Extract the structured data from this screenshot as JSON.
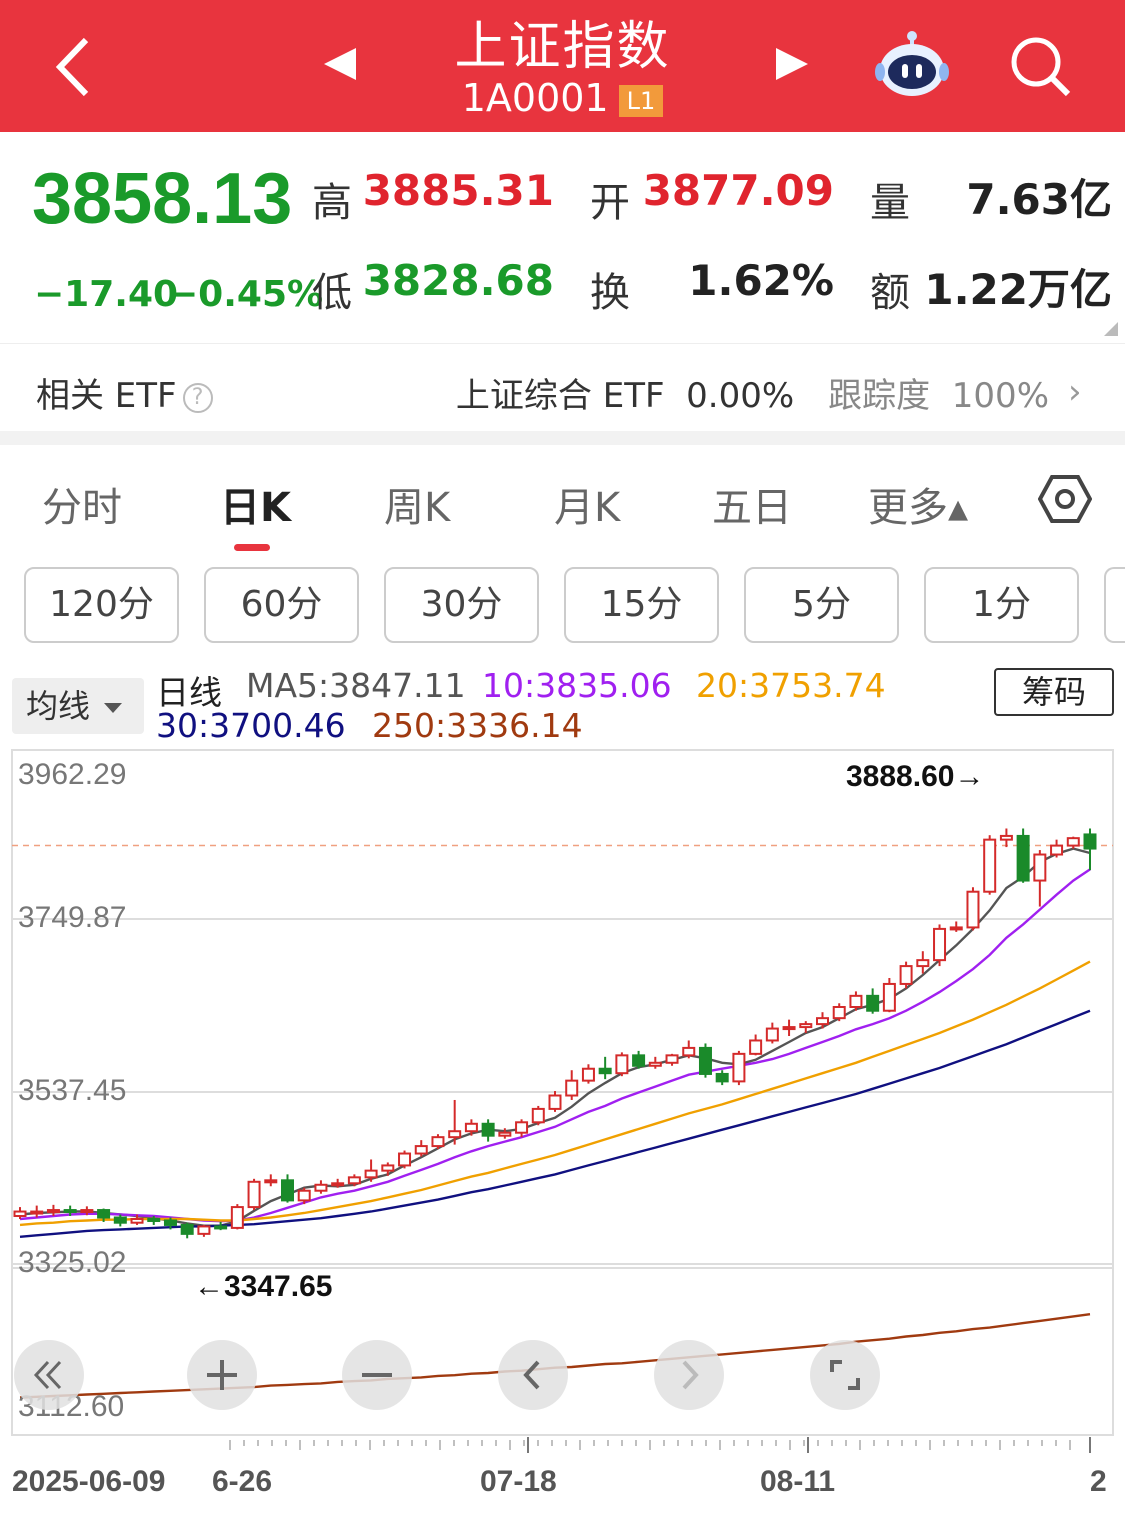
{
  "header": {
    "title": "上证指数",
    "code": "1A0001",
    "level_badge": "L1",
    "icons": [
      "back-icon",
      "prev-icon",
      "next-icon",
      "robot-icon",
      "search-icon"
    ]
  },
  "quote": {
    "price": "3858.13",
    "change": "−17.40",
    "change_pct": "−0.45%",
    "high_label": "高",
    "high": "3885.31",
    "low_label": "低",
    "low": "3828.68",
    "open_label": "开",
    "open": "3877.09",
    "turnover_label": "换",
    "turnover": "1.62%",
    "volume_label": "量",
    "volume": "7.63亿",
    "amount_label": "额",
    "amount": "1.22万亿"
  },
  "etf": {
    "label": "相关 ETF",
    "help": "?",
    "name": "上证综合 ETF",
    "pct": "0.00%",
    "tracking_label": "跟踪度",
    "tracking": "100%"
  },
  "tabs": [
    "分时",
    "日K",
    "周K",
    "月K",
    "五日",
    "更多▴"
  ],
  "active_tab": "日K",
  "periods": [
    "120分",
    "60分",
    "30分",
    "15分",
    "5分",
    "1分"
  ],
  "ma": {
    "toggle": "均线",
    "line_label": "日线",
    "ma5": "MA5:3847.11",
    "ma10": "10:3835.06",
    "ma20": "20:3753.74",
    "ma30": "30:3700.46",
    "ma250": "250:3336.14",
    "chip_button": "筹码",
    "colors": {
      "ma5": "#555555",
      "ma10": "#a020f0",
      "ma20": "#f0a000",
      "ma30": "#101080",
      "ma250": "#a03a10",
      "up": "#d42a2a",
      "down": "#1a8a2a"
    }
  },
  "chart_data": {
    "type": "candlestick",
    "y_ticks": [
      "3962.29",
      "3749.87",
      "3537.45",
      "3325.02",
      "3112.60"
    ],
    "x_ticks": [
      "2025-06-09",
      "6-26",
      "07-18",
      "08-11",
      "2"
    ],
    "max_label": "3888.60→",
    "min_label": "←3347.65",
    "ylim": [
      3112.6,
      3962.29
    ],
    "candles": [
      [
        3364,
        3370,
        3376,
        3360
      ],
      [
        3369,
        3370,
        3378,
        3362
      ],
      [
        3370,
        3372,
        3379,
        3364
      ],
      [
        3372,
        3370,
        3378,
        3364
      ],
      [
        3370,
        3372,
        3377,
        3365
      ],
      [
        3372,
        3362,
        3374,
        3356
      ],
      [
        3362,
        3355,
        3366,
        3350
      ],
      [
        3355,
        3360,
        3366,
        3352
      ],
      [
        3360,
        3358,
        3364,
        3352
      ],
      [
        3358,
        3352,
        3362,
        3346
      ],
      [
        3352,
        3340,
        3355,
        3334
      ],
      [
        3340,
        3350,
        3352,
        3336
      ],
      [
        3350,
        3348,
        3356,
        3345
      ],
      [
        3348,
        3376,
        3380,
        3346
      ],
      [
        3376,
        3410,
        3414,
        3372
      ],
      [
        3410,
        3412,
        3420,
        3404
      ],
      [
        3412,
        3385,
        3420,
        3382
      ],
      [
        3385,
        3398,
        3402,
        3380
      ],
      [
        3398,
        3406,
        3412,
        3394
      ],
      [
        3406,
        3408,
        3414,
        3402
      ],
      [
        3408,
        3416,
        3420,
        3404
      ],
      [
        3416,
        3425,
        3440,
        3410
      ],
      [
        3425,
        3432,
        3436,
        3418
      ],
      [
        3432,
        3448,
        3452,
        3428
      ],
      [
        3448,
        3458,
        3466,
        3444
      ],
      [
        3458,
        3470,
        3474,
        3454
      ],
      [
        3470,
        3478,
        3520,
        3460
      ],
      [
        3478,
        3488,
        3494,
        3472
      ],
      [
        3488,
        3472,
        3494,
        3464
      ],
      [
        3472,
        3476,
        3482,
        3468
      ],
      [
        3476,
        3490,
        3494,
        3470
      ],
      [
        3490,
        3508,
        3512,
        3486
      ],
      [
        3508,
        3526,
        3532,
        3504
      ],
      [
        3526,
        3546,
        3560,
        3520
      ],
      [
        3546,
        3562,
        3568,
        3542
      ],
      [
        3562,
        3556,
        3578,
        3548
      ],
      [
        3556,
        3580,
        3584,
        3552
      ],
      [
        3580,
        3566,
        3586,
        3562
      ],
      [
        3566,
        3570,
        3578,
        3562
      ],
      [
        3570,
        3580,
        3582,
        3566
      ],
      [
        3580,
        3590,
        3600,
        3576
      ],
      [
        3590,
        3555,
        3596,
        3550
      ],
      [
        3555,
        3545,
        3560,
        3540
      ],
      [
        3545,
        3582,
        3586,
        3540
      ],
      [
        3582,
        3600,
        3608,
        3580
      ],
      [
        3600,
        3616,
        3624,
        3596
      ],
      [
        3616,
        3618,
        3628,
        3606
      ],
      [
        3618,
        3622,
        3626,
        3610
      ],
      [
        3622,
        3630,
        3638,
        3616
      ],
      [
        3630,
        3645,
        3650,
        3626
      ],
      [
        3645,
        3660,
        3666,
        3640
      ],
      [
        3660,
        3640,
        3670,
        3636
      ],
      [
        3640,
        3676,
        3684,
        3638
      ],
      [
        3676,
        3700,
        3706,
        3670
      ],
      [
        3700,
        3708,
        3720,
        3690
      ],
      [
        3708,
        3750,
        3756,
        3700
      ],
      [
        3750,
        3752,
        3760,
        3746
      ],
      [
        3752,
        3800,
        3806,
        3748
      ],
      [
        3800,
        3870,
        3876,
        3796
      ],
      [
        3870,
        3875,
        3885,
        3860
      ],
      [
        3875,
        3815,
        3885,
        3812
      ],
      [
        3815,
        3850,
        3856,
        3780
      ],
      [
        3850,
        3862,
        3870,
        3846
      ],
      [
        3862,
        3872,
        3874,
        3858
      ],
      [
        3877,
        3858,
        3885,
        3829
      ]
    ],
    "series": [
      {
        "name": "MA5",
        "values": [
          3366,
          3368,
          3369,
          3370,
          3370,
          3368,
          3366,
          3364,
          3361,
          3358,
          3354,
          3351,
          3351,
          3357,
          3371,
          3384,
          3393,
          3402,
          3405,
          3404,
          3406,
          3414,
          3420,
          3432,
          3443,
          3455,
          3467,
          3475,
          3480,
          3478,
          3481,
          3489,
          3496,
          3511,
          3529,
          3543,
          3556,
          3564,
          3568,
          3574,
          3580,
          3576,
          3570,
          3568,
          3574,
          3586,
          3598,
          3610,
          3618,
          3630,
          3642,
          3648,
          3656,
          3670,
          3688,
          3708,
          3728,
          3750,
          3775,
          3805,
          3820,
          3840,
          3851,
          3858,
          3852
        ]
      },
      {
        "name": "MA10",
        "values": [
          3360,
          3362,
          3364,
          3366,
          3367,
          3367,
          3366,
          3365,
          3364,
          3362,
          3360,
          3358,
          3357,
          3358,
          3362,
          3368,
          3375,
          3382,
          3389,
          3394,
          3398,
          3404,
          3410,
          3418,
          3426,
          3434,
          3443,
          3451,
          3458,
          3464,
          3470,
          3477,
          3484,
          3494,
          3504,
          3512,
          3522,
          3530,
          3538,
          3546,
          3554,
          3558,
          3562,
          3566,
          3570,
          3575,
          3582,
          3590,
          3598,
          3606,
          3615,
          3622,
          3630,
          3640,
          3652,
          3665,
          3680,
          3696,
          3715,
          3738,
          3756,
          3776,
          3796,
          3815,
          3830
        ]
      },
      {
        "name": "MA20",
        "values": [
          3352,
          3354,
          3355,
          3357,
          3358,
          3359,
          3359,
          3360,
          3360,
          3360,
          3360,
          3359,
          3358,
          3358,
          3360,
          3362,
          3365,
          3368,
          3372,
          3376,
          3380,
          3384,
          3389,
          3394,
          3399,
          3405,
          3411,
          3417,
          3422,
          3428,
          3434,
          3440,
          3446,
          3453,
          3460,
          3467,
          3474,
          3481,
          3488,
          3495,
          3502,
          3508,
          3514,
          3521,
          3528,
          3535,
          3542,
          3549,
          3556,
          3563,
          3570,
          3578,
          3586,
          3594,
          3602,
          3610,
          3619,
          3628,
          3638,
          3648,
          3659,
          3670,
          3682,
          3694,
          3706
        ]
      },
      {
        "name": "MA30",
        "values": [
          3336,
          3338,
          3340,
          3342,
          3344,
          3345,
          3346,
          3347,
          3348,
          3349,
          3350,
          3350,
          3351,
          3352,
          3353,
          3355,
          3357,
          3359,
          3361,
          3364,
          3367,
          3370,
          3374,
          3378,
          3382,
          3386,
          3391,
          3396,
          3400,
          3405,
          3410,
          3415,
          3420,
          3426,
          3432,
          3438,
          3444,
          3450,
          3456,
          3462,
          3468,
          3474,
          3480,
          3486,
          3492,
          3498,
          3504,
          3510,
          3516,
          3522,
          3528,
          3535,
          3542,
          3549,
          3556,
          3563,
          3571,
          3579,
          3587,
          3595,
          3604,
          3613,
          3622,
          3631,
          3640
        ]
      },
      {
        "name": "MA250",
        "values": [
          3120,
          3121,
          3122,
          3123,
          3124,
          3125,
          3126,
          3127,
          3128,
          3129,
          3130,
          3131,
          3132,
          3133,
          3134,
          3136,
          3137,
          3138,
          3139,
          3141,
          3142,
          3143,
          3145,
          3146,
          3147,
          3149,
          3150,
          3152,
          3153,
          3155,
          3156,
          3158,
          3160,
          3161,
          3163,
          3165,
          3166,
          3168,
          3170,
          3172,
          3174,
          3176,
          3178,
          3180,
          3182,
          3184,
          3186,
          3188,
          3190,
          3192,
          3195,
          3197,
          3199,
          3202,
          3204,
          3207,
          3209,
          3212,
          3214,
          3217,
          3220,
          3223,
          3226,
          3229,
          3232
        ]
      }
    ],
    "ref_line": 3858.13,
    "grid": true
  },
  "chart_controls": [
    "rewind-icon",
    "zoom-in-icon",
    "zoom-out-icon",
    "left-icon",
    "right-icon",
    "fullscreen-icon"
  ]
}
